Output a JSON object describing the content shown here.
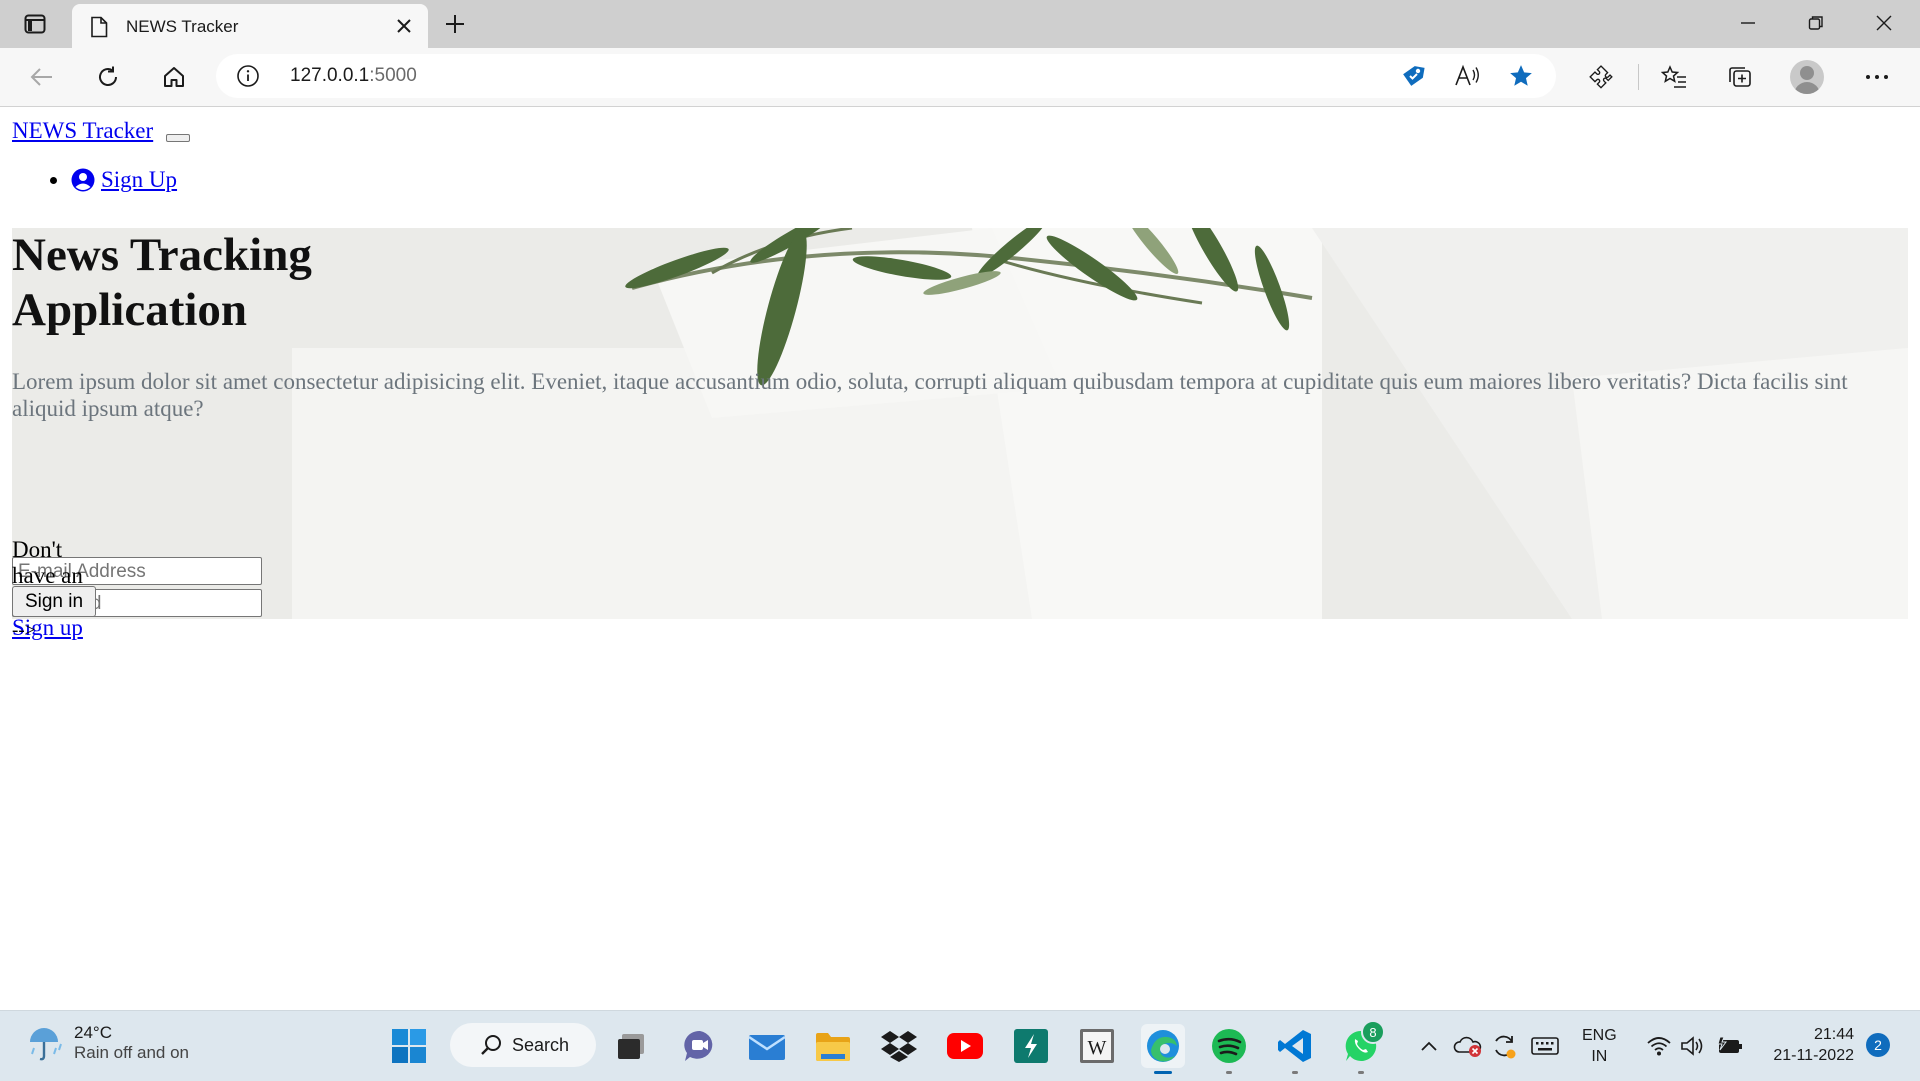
{
  "browser": {
    "tab_title": "NEWS Tracker",
    "url_host": "127.0.0.1",
    "url_port": ":5000"
  },
  "page": {
    "brand": "NEWS Tracker",
    "nav": {
      "signup_label": "Sign Up"
    },
    "hero": {
      "title": "News Tracking Application",
      "description": "Lorem ipsum dolor sit amet consectetur adipisicing elit. Eveniet, itaque accusantium odio, soluta, corrupti aliquam quibusdam tempora at cupiditate quis eum maiores libero veritatis? Dicta facilis sint aliquid ipsum atque?",
      "email_placeholder": "E-mail Address",
      "password_placeholder": "Password",
      "account_prompt": "Don't have an account?",
      "signup_link": "Sign up",
      "signin_button": "Sign in"
    },
    "comment_tail": "-->"
  },
  "taskbar": {
    "weather_temp": "24°C",
    "weather_condition": "Rain off and on",
    "search_label": "Search",
    "whatsapp_badge": "8",
    "language": "ENG",
    "region": "IN",
    "time": "21:44",
    "date": "21-11-2022",
    "notification_count": "2"
  },
  "colors": {
    "link": "#0000ee",
    "muted_text": "#6c757d",
    "favorite_star": "#0f6cbd",
    "taskbar_bg": "#dde7ee"
  }
}
